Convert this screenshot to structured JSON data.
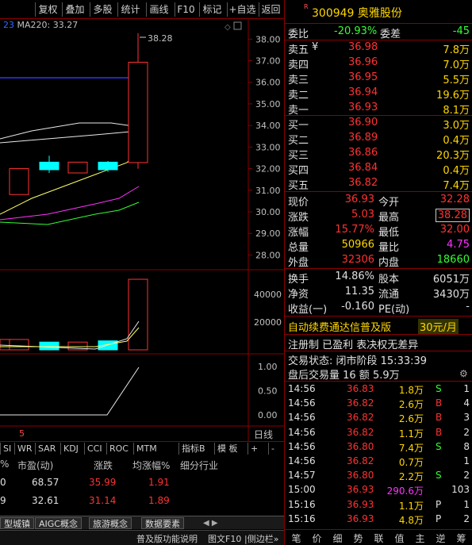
{
  "toolbar": {
    "items": [
      "复权",
      "叠加",
      "多股",
      "统计",
      "画线",
      "F10",
      "标记",
      "+自选",
      "返回"
    ]
  },
  "chart": {
    "ma_label": "MA220: 33.27",
    "ma_prefix": "23",
    "high_annotation": "38.28",
    "price_ticks": [
      "38.00",
      "37.00",
      "36.00",
      "35.00",
      "34.00",
      "33.00",
      "32.00",
      "31.00",
      "30.00",
      "29.00",
      "28.00"
    ],
    "volume_ticks": [
      "40000",
      "20000"
    ],
    "indicator_ticks": [
      "1.00",
      "0.50",
      "0.00"
    ],
    "x_marker": "5",
    "x_end_label": "日线"
  },
  "chart_data": [
    {
      "type": "candlestick",
      "candles": [
        {
          "open": 30.8,
          "close": 32.0,
          "high": 32.0,
          "low": 30.8,
          "color": "red"
        },
        {
          "open": 32.3,
          "close": 31.95,
          "high": 32.6,
          "low": 31.8,
          "color": "cyan"
        },
        {
          "open": 31.8,
          "close": 32.3,
          "high": 32.3,
          "low": 31.8,
          "color": "red"
        },
        {
          "open": 32.3,
          "close": 31.95,
          "high": 32.35,
          "low": 31.85,
          "color": "cyan"
        },
        {
          "open": 32.28,
          "close": 36.93,
          "high": 38.28,
          "low": 32.0,
          "color": "red"
        }
      ],
      "ma220": 33.27,
      "ylim": [
        27.5,
        38.6
      ]
    },
    {
      "type": "bar",
      "title": "volume",
      "values": [
        7500,
        7500,
        5600,
        5600,
        6500,
        50966
      ],
      "ylim": [
        0,
        55000
      ]
    }
  ],
  "tabs": {
    "items": [
      "SI",
      "WR",
      "SAR",
      "KDJ",
      "CCI",
      "ROC",
      "MTM",
      "指标B",
      "模 板",
      "+",
      "-"
    ]
  },
  "table": {
    "headers": [
      "%",
      "市盈(动)",
      "涨跌",
      "均涨幅%",
      "细分行业"
    ],
    "rows": [
      {
        "c0": "0",
        "pe": "68.57",
        "chg": "35.99",
        "avg": "1.91"
      },
      {
        "c0": "9",
        "pe": "32.61",
        "chg": "31.14",
        "avg": "1.89"
      }
    ]
  },
  "bottom_tabs": [
    "型城镇",
    "AIGC概念",
    "旅游概念",
    "数据要素"
  ],
  "status_line": {
    "left": "普及版功能说明",
    "mid": "图文F10",
    "right": "|侧边栏»"
  },
  "quote": {
    "r_mark": "R",
    "code": "300949 奥雅股份",
    "weibi_label": "委比",
    "weibi": "-20.93%",
    "weicha_label": "委差",
    "weicha": "-45",
    "asks": [
      {
        "label": "卖五",
        "mark": "¥",
        "price": "36.98",
        "vol": "7.8万"
      },
      {
        "label": "卖四",
        "mark": "",
        "price": "36.96",
        "vol": "7.0万"
      },
      {
        "label": "卖三",
        "mark": "",
        "price": "36.95",
        "vol": "5.5万"
      },
      {
        "label": "卖二",
        "mark": "",
        "price": "36.94",
        "vol": "19.6万"
      },
      {
        "label": "卖一",
        "mark": "",
        "price": "36.93",
        "vol": "8.1万"
      }
    ],
    "bids": [
      {
        "label": "买一",
        "price": "36.90",
        "vol": "3.0万"
      },
      {
        "label": "买二",
        "price": "36.89",
        "vol": "0.4万"
      },
      {
        "label": "买三",
        "price": "36.86",
        "vol": "20.3万"
      },
      {
        "label": "买四",
        "price": "36.84",
        "vol": "0.4万"
      },
      {
        "label": "买五",
        "price": "36.82",
        "vol": "7.4万"
      }
    ],
    "stats": [
      {
        "l1": "现价",
        "v1": "36.93",
        "l2": "今开",
        "v2": "32.28"
      },
      {
        "l1": "涨跌",
        "v1": "5.03",
        "l2": "最高",
        "v2": "38.28"
      },
      {
        "l1": "涨幅",
        "v1": "15.77%",
        "l2": "最低",
        "v2": "32.00"
      },
      {
        "l1": "总量",
        "v1": "50966",
        "l2": "量比",
        "v2": "4.75"
      },
      {
        "l1": "外盘",
        "v1": "32306",
        "l2": "内盘",
        "v2": "18660"
      }
    ],
    "fund": [
      {
        "l1": "换手",
        "v1": "14.86%",
        "l2": "股本",
        "v2": "6051万"
      },
      {
        "l1": "净资",
        "v1": "11.35",
        "l2": "流通",
        "v2": "3430万"
      },
      {
        "l1": "收益(一)",
        "v1": "-0.160",
        "l2": "PE(动)",
        "v2": "-"
      }
    ],
    "promo": "自动续费通达信普及版",
    "price_tag": "30元/月",
    "promo2": "注册制 已盈利 表决权无差异",
    "trade_status": "交易状态: 闭市阶段 15:33:39",
    "after_hours": "盘后交易量 16 额 5.9万"
  },
  "ticks": [
    {
      "time": "14:56",
      "price": "36.83",
      "vol": "1.8万",
      "bs": "S",
      "n": "1"
    },
    {
      "time": "14:56",
      "price": "36.82",
      "vol": "2.6万",
      "bs": "B",
      "n": "4"
    },
    {
      "time": "14:56",
      "price": "36.82",
      "vol": "2.6万",
      "bs": "B",
      "n": "3"
    },
    {
      "time": "14:56",
      "price": "36.82",
      "vol": "1.1万",
      "bs": "B",
      "n": "2"
    },
    {
      "time": "14:56",
      "price": "36.80",
      "vol": "7.4万",
      "bs": "S",
      "n": "8"
    },
    {
      "time": "14:56",
      "price": "36.82",
      "vol": "0.7万",
      "bs": "",
      "n": "1"
    },
    {
      "time": "14:57",
      "price": "36.80",
      "vol": "2.2万",
      "bs": "S",
      "n": "2"
    },
    {
      "time": "15:00",
      "price": "36.93",
      "vol": "290.6万",
      "bs": "",
      "n": "103"
    },
    {
      "time": "15:16",
      "price": "36.93",
      "vol": "1.1万",
      "bs": "P",
      "n": "1"
    },
    {
      "time": "15:16",
      "price": "36.93",
      "vol": "4.8万",
      "bs": "P",
      "n": "2"
    }
  ],
  "bottom_bar": [
    "笔",
    "价",
    "细",
    "势",
    "联",
    "值",
    "主",
    "逆",
    "筹"
  ]
}
